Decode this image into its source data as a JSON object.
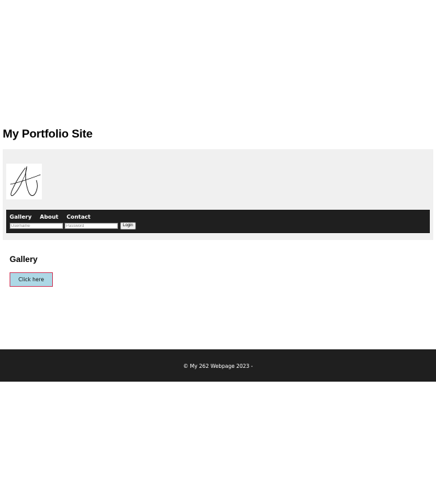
{
  "site": {
    "title": "My Portfolio Site"
  },
  "header": {
    "logo_icon": "signature-logo-icon"
  },
  "nav": {
    "links": [
      {
        "label": "Gallery"
      },
      {
        "label": "About"
      },
      {
        "label": "Contact"
      }
    ],
    "login": {
      "username_placeholder": "Username",
      "password_placeholder": "Password",
      "button_label": "Login"
    }
  },
  "main": {
    "section_heading": "Gallery",
    "cta_label": "Click here"
  },
  "footer": {
    "text": "© My 262 Webpage 2023 -"
  },
  "colors": {
    "header_panel_bg": "#f0f0f0",
    "navbar_bg": "#1f1f1f",
    "footer_bg": "#1f1f1f",
    "cta_bg": "#add8e6",
    "cta_border": "#d03a5a"
  }
}
